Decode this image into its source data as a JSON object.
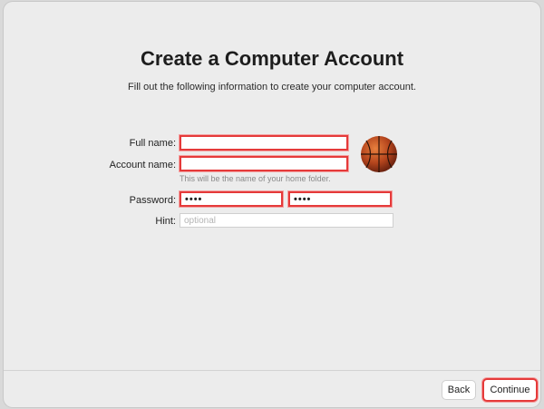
{
  "page": {
    "title": "Create a Computer Account",
    "subtitle": "Fill out the following information to create your computer account."
  },
  "form": {
    "full_name_label": "Full name:",
    "account_name_label": "Account name:",
    "home_folder_note": "This will be the name of your home folder.",
    "password_label": "Password:",
    "password_value": "••••",
    "verify_value": "••••",
    "hint_label": "Hint:",
    "hint_placeholder": "optional",
    "highlight_color": "#e53a3a"
  },
  "avatar": {
    "icon": "basketball-icon"
  },
  "footer": {
    "back_label": "Back",
    "continue_label": "Continue"
  }
}
